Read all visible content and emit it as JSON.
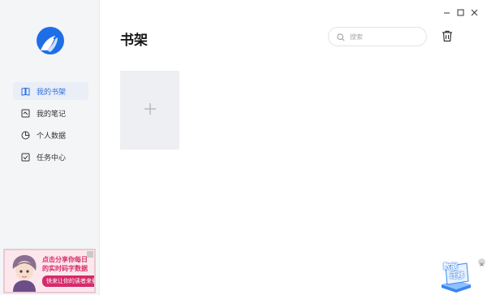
{
  "sidebar": {
    "items": [
      {
        "label": "我的书架",
        "icon": "book-icon",
        "active": true
      },
      {
        "label": "我的笔记",
        "icon": "note-icon",
        "active": false
      },
      {
        "label": "个人数据",
        "icon": "pie-chart-icon",
        "active": false
      },
      {
        "label": "任务中心",
        "icon": "task-icon",
        "active": false
      }
    ],
    "ad": {
      "line1": "点击分享你每日",
      "line2": "的实时码字数据",
      "button": "快来让你的读者来催更吧！"
    }
  },
  "main": {
    "title": "书架",
    "search_placeholder": "搜索"
  },
  "migrate_badge": {
    "line1": "数据",
    "line2": "迁移"
  },
  "colors": {
    "accent": "#2f6fe0",
    "sidebar_bg": "#f4f5f7",
    "card_bg": "#edeff2"
  }
}
